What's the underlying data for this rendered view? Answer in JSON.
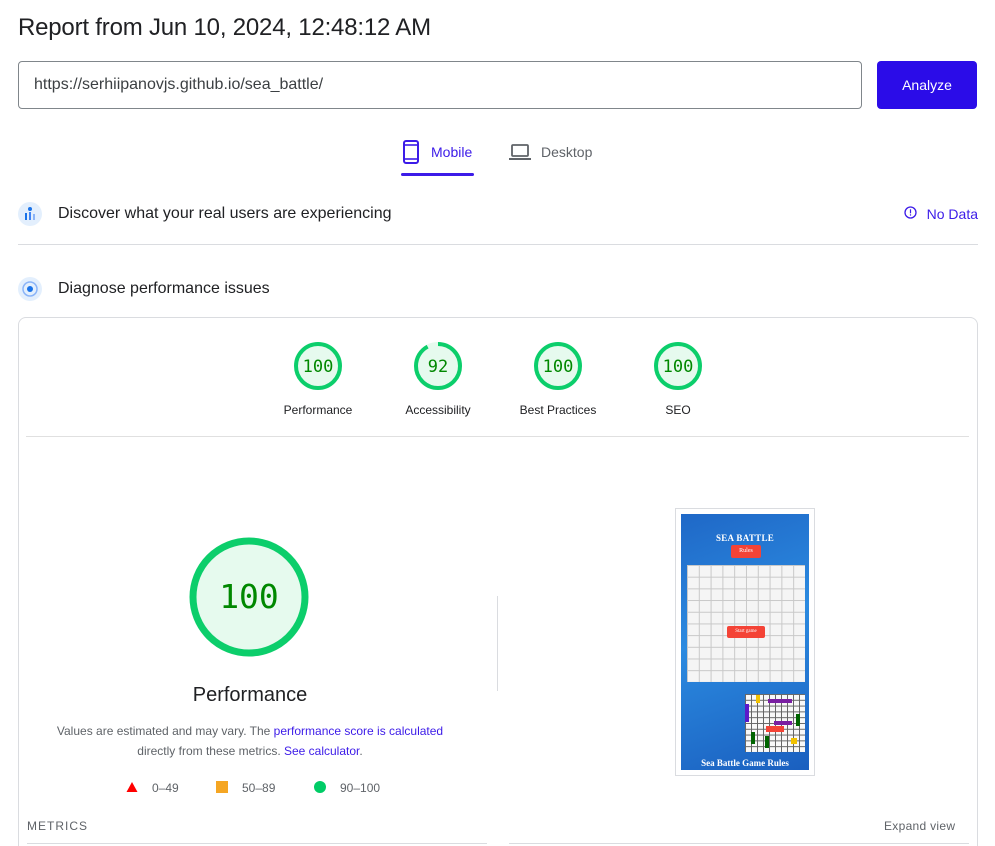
{
  "report": {
    "title": "Report from Jun 10, 2024, 12:48:12 AM"
  },
  "url_input": {
    "value": "https://serhiipanovjs.github.io/sea_battle/"
  },
  "analyze_button": {
    "label": "Analyze"
  },
  "tabs": [
    {
      "label": "Mobile",
      "icon": "mobile-phone-icon",
      "selected": true
    },
    {
      "label": "Desktop",
      "icon": "laptop-icon",
      "selected": false
    }
  ],
  "field_data": {
    "heading": "Discover what your real users are experiencing",
    "status": "No Data",
    "status_icon": "info-icon"
  },
  "lab_data": {
    "heading": "Diagnose performance issues"
  },
  "scores": [
    {
      "value": 100,
      "label": "Performance"
    },
    {
      "value": 92,
      "label": "Accessibility"
    },
    {
      "value": 100,
      "label": "Best Practices"
    },
    {
      "value": 100,
      "label": "SEO"
    }
  ],
  "performance": {
    "score": "100",
    "title": "Performance",
    "desc_prefix": "Values are estimated and may vary. The ",
    "desc_link1": "performance score is calculated",
    "desc_mid": "directly from these metrics. ",
    "desc_link2": "See calculator",
    "desc_suffix": "."
  },
  "legend": [
    {
      "range": "0–49",
      "shape": "triangle",
      "color": "#ff0000"
    },
    {
      "range": "50–89",
      "shape": "square",
      "color": "#f5a623"
    },
    {
      "range": "90–100",
      "shape": "circle",
      "color": "#00cc66"
    }
  ],
  "screenshot": {
    "title": "SEA BATTLE",
    "rules_button": "Rules",
    "start_button": "Start game",
    "footer": "Sea Battle Game Rules"
  },
  "metrics": {
    "label": "METRICS",
    "expand": "Expand view"
  },
  "colors": {
    "accent": "#3c1be8",
    "pass": "#0cce6b",
    "pass_text": "#008800",
    "pass_fill": "#e6faee"
  }
}
